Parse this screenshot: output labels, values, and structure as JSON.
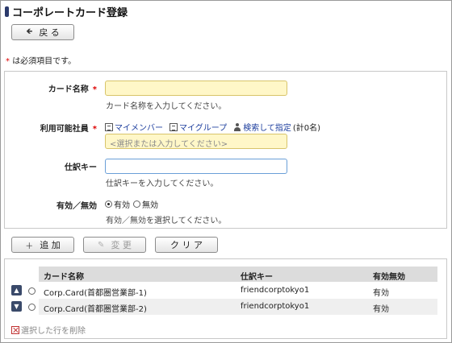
{
  "page": {
    "title": "コーポレートカード登録",
    "back_label": "戻 る",
    "required_note": "は必須項目です。",
    "required_mark": "*"
  },
  "form": {
    "card_name": {
      "label": "カード名称",
      "value": "",
      "hint": "カード名称を入力してください。"
    },
    "users": {
      "label": "利用可能社員",
      "my_members": "マイメンバー",
      "my_groups": "マイグループ",
      "search_assign": "検索して指定",
      "count": "(計0名)",
      "placeholder": "<選択または入力してください>"
    },
    "journal_key": {
      "label": "仕訳キー",
      "value": "",
      "hint": "仕訳キーを入力してください。"
    },
    "validity": {
      "label": "有効／無効",
      "options": [
        "有効",
        "無効"
      ],
      "selected": "有効",
      "hint": "有効／無効を選択してください。"
    }
  },
  "actions": {
    "add": "追 加",
    "edit": "変 更",
    "clear": "ク リ ア"
  },
  "table": {
    "headers": [
      "カード名称",
      "仕訳キー",
      "有効無効"
    ],
    "rows": [
      {
        "card_name": "Corp.Card(首都圏営業部-1)",
        "journal_key": "friendcorptokyo1",
        "status": "有効"
      },
      {
        "card_name": "Corp.Card(首都圏営業部-2)",
        "journal_key": "friendcorptokyo1",
        "status": "有効"
      }
    ],
    "delete_label": "選択した行を削除"
  },
  "icons": {
    "back": "arrow-left-icon",
    "add": "plus-icon",
    "edit": "pencil-icon",
    "up": "chevron-up-icon",
    "down": "chevron-down-icon",
    "delete": "delete-x-icon"
  },
  "colors": {
    "required": "#dd0000",
    "link": "#1e3f9e",
    "required_field_bg": "#fff7c8",
    "focused_border": "#6a9fd8"
  }
}
